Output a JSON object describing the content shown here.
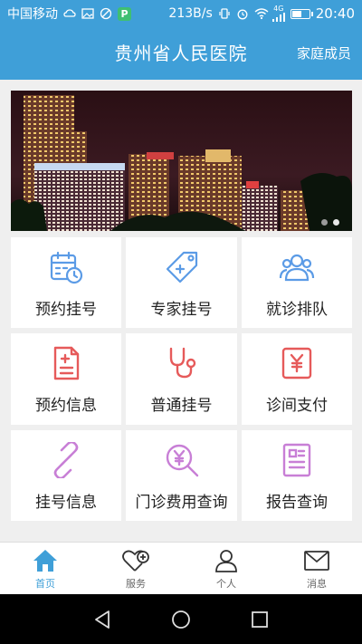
{
  "status_bar": {
    "carrier": "中国移动",
    "speed": "213B/s",
    "network": "4G",
    "time": "20:40",
    "battery_level": 0.6,
    "app_badge": "P"
  },
  "header": {
    "title": "贵州省人民医院",
    "family_label": "家庭成员"
  },
  "banner": {
    "slides": 2,
    "active_slide": 2
  },
  "tiles": [
    {
      "label": "预约挂号",
      "icon": "calendar-clock-icon",
      "color": "#5b9be6"
    },
    {
      "label": "专家挂号",
      "icon": "tag-plus-icon",
      "color": "#5b9be6"
    },
    {
      "label": "就诊排队",
      "icon": "people-group-icon",
      "color": "#5b9be6"
    },
    {
      "label": "预约信息",
      "icon": "document-plus-icon",
      "color": "#e65a5a"
    },
    {
      "label": "普通挂号",
      "icon": "stethoscope-icon",
      "color": "#e65a5a"
    },
    {
      "label": "诊间支付",
      "icon": "yuan-card-icon",
      "color": "#e65a5a"
    },
    {
      "label": "挂号信息",
      "icon": "link-icon",
      "color": "#c87fd6"
    },
    {
      "label": "门诊费用查询",
      "icon": "yuan-search-icon",
      "color": "#c87fd6"
    },
    {
      "label": "报告查询",
      "icon": "report-icon",
      "color": "#c87fd6"
    }
  ],
  "nav": {
    "items": [
      {
        "label": "首页",
        "icon": "home-icon",
        "active": true
      },
      {
        "label": "服务",
        "icon": "heart-plus-icon",
        "active": false
      },
      {
        "label": "个人",
        "icon": "person-icon",
        "active": false
      },
      {
        "label": "消息",
        "icon": "mail-icon",
        "active": false
      }
    ]
  },
  "colors": {
    "primary": "#3f9fd8",
    "blue_icon": "#5b9be6",
    "red_icon": "#e65a5a",
    "purple_icon": "#c87fd6"
  }
}
